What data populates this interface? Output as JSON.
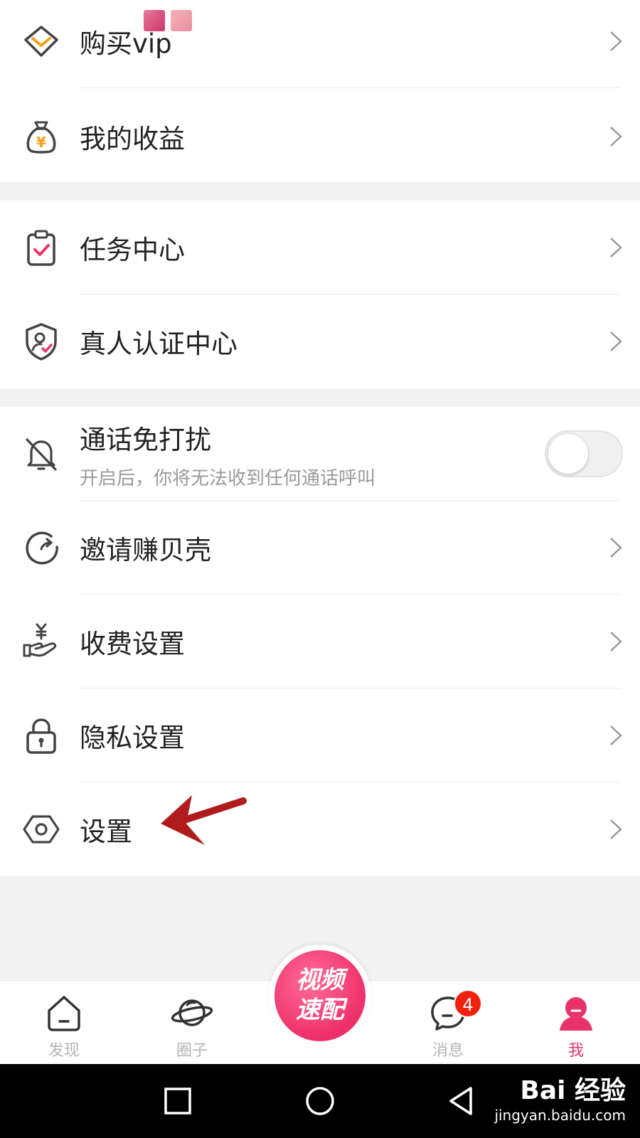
{
  "menu": {
    "buy_vip": "购买vip",
    "my_earnings": "我的收益",
    "task_center": "任务中心",
    "verify_center": "真人认证中心",
    "dnd": {
      "label": "通话免打扰",
      "sublabel": "开启后，你将无法收到任何通话呼叫",
      "enabled": false
    },
    "invite": "邀请赚贝壳",
    "fee_settings": "收费设置",
    "privacy_settings": "隐私设置",
    "settings": "设置"
  },
  "tabbar": {
    "discover": "发现",
    "circle": "圈子",
    "center_line1": "视频",
    "center_line2": "速配",
    "messages": "消息",
    "messages_badge": "4",
    "me": "我"
  },
  "watermark": {
    "line1": "Bai 经验",
    "line2": "jingyan.baidu.com"
  },
  "colors": {
    "accent": "#e8336a",
    "badge": "#f2200f",
    "arrow": "#b01c1c"
  }
}
